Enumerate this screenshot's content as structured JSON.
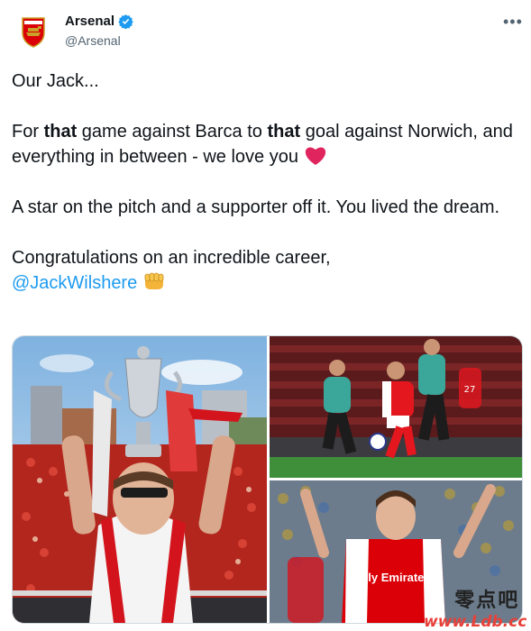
{
  "header": {
    "display_name": "Arsenal",
    "handle": "@Arsenal",
    "more_label": "•••"
  },
  "tweet": {
    "line1": "Our Jack...",
    "p2": {
      "t1": "For ",
      "b1": "that",
      "t2": " game against Barca to ",
      "b2": "that",
      "t3": " goal against Norwich, and everything in between - we love you "
    },
    "line3": "A star on the pitch and a supporter off it. You lived the dream.",
    "line4": "Congratulations on an incredible career,",
    "mention": "@JackWilshere"
  },
  "media": {
    "photo3_shirt_text": "Fly Emirates",
    "photo2_number": "27"
  },
  "watermark": {
    "chinese": "零点吧",
    "url": "www.Ldb.cc"
  },
  "colors": {
    "link": "#1d9bf0",
    "verified": "#1d9bf0",
    "heart": "#e0245e",
    "arsenal_red": "#db0007"
  },
  "icons": [
    "arsenal-crest-icon",
    "verified-badge-icon",
    "more-options-icon",
    "red-heart-emoji-icon",
    "fist-bump-emoji-icon"
  ]
}
